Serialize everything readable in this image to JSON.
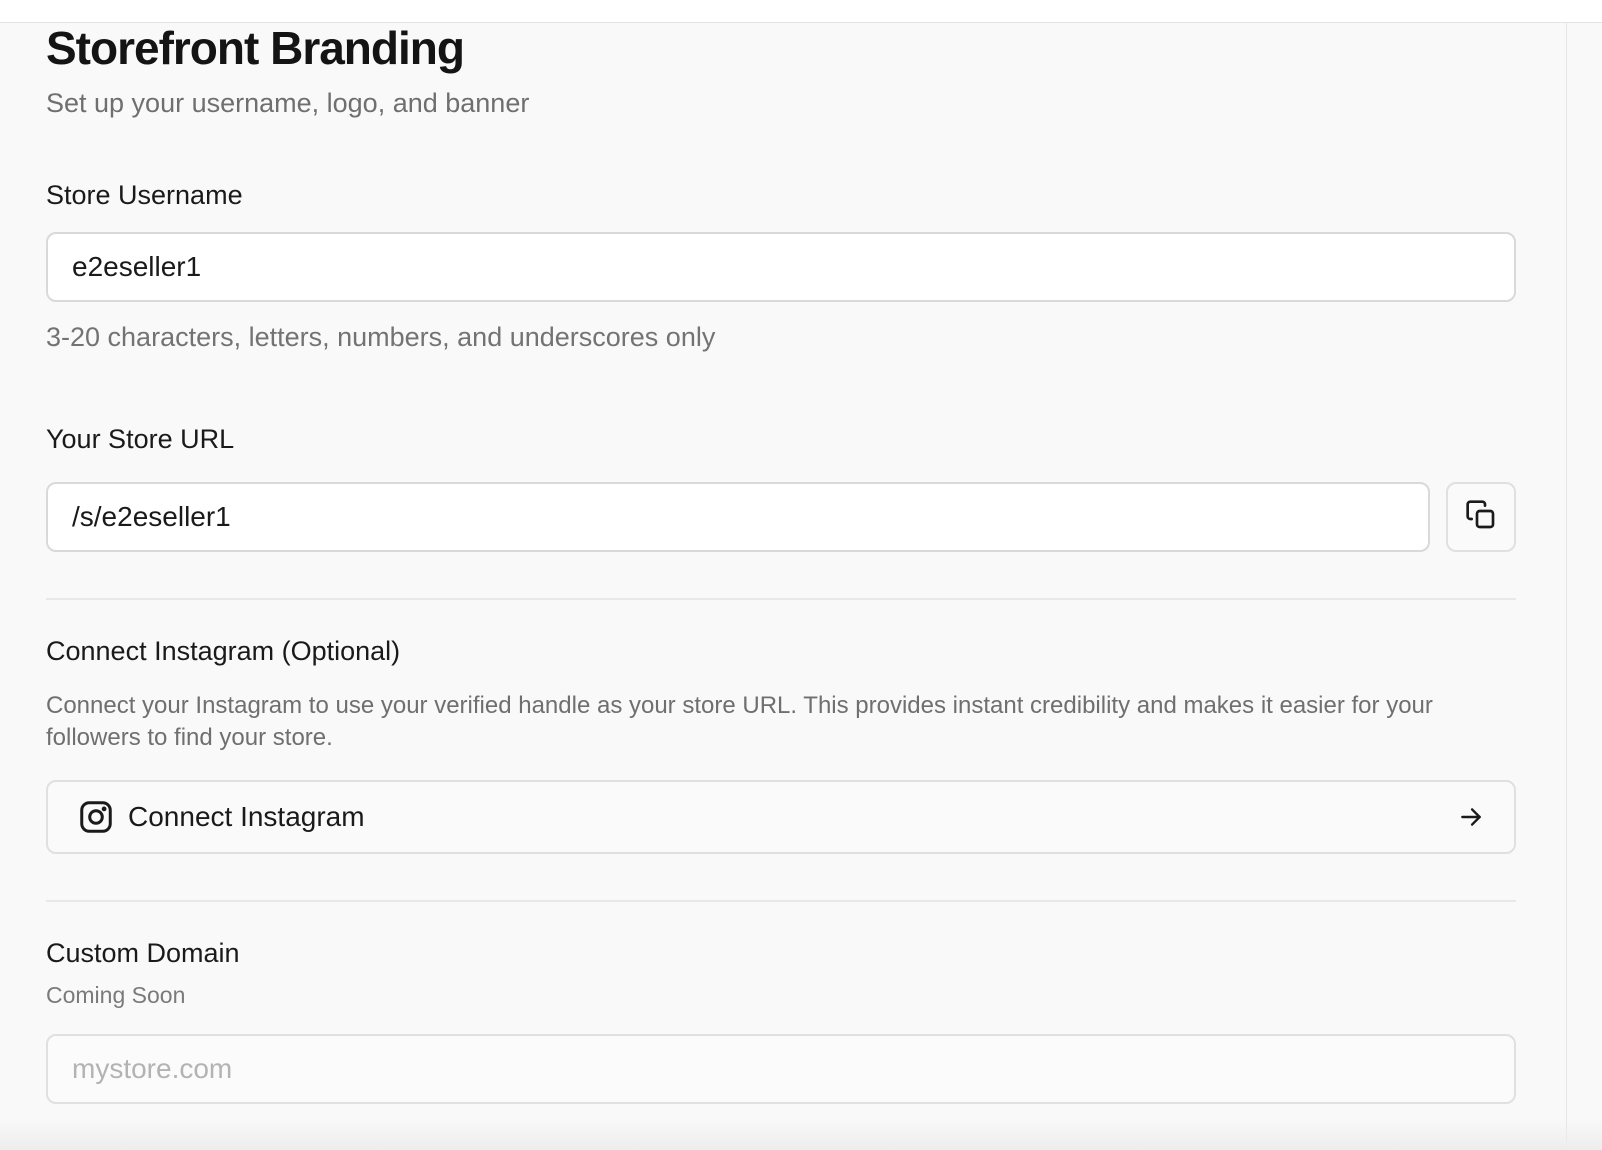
{
  "header": {
    "title": "Storefront Branding",
    "subtitle": "Set up your username, logo, and banner"
  },
  "username": {
    "label": "Store Username",
    "value": "e2eseller1",
    "hint": "3-20 characters, letters, numbers, and underscores only"
  },
  "store_url": {
    "label": "Your Store URL",
    "value": "/s/e2eseller1",
    "copy_icon": "copy-icon"
  },
  "instagram": {
    "label": "Connect Instagram (Optional)",
    "description": "Connect your Instagram to use your verified handle as your store URL. This provides instant credibility and makes it easier for your followers to find your store.",
    "button_label": "Connect Instagram",
    "icon": "instagram-icon",
    "arrow_icon": "arrow-right-icon"
  },
  "custom_domain": {
    "label": "Custom Domain",
    "status": "Coming Soon",
    "placeholder": "mystore.com"
  }
}
